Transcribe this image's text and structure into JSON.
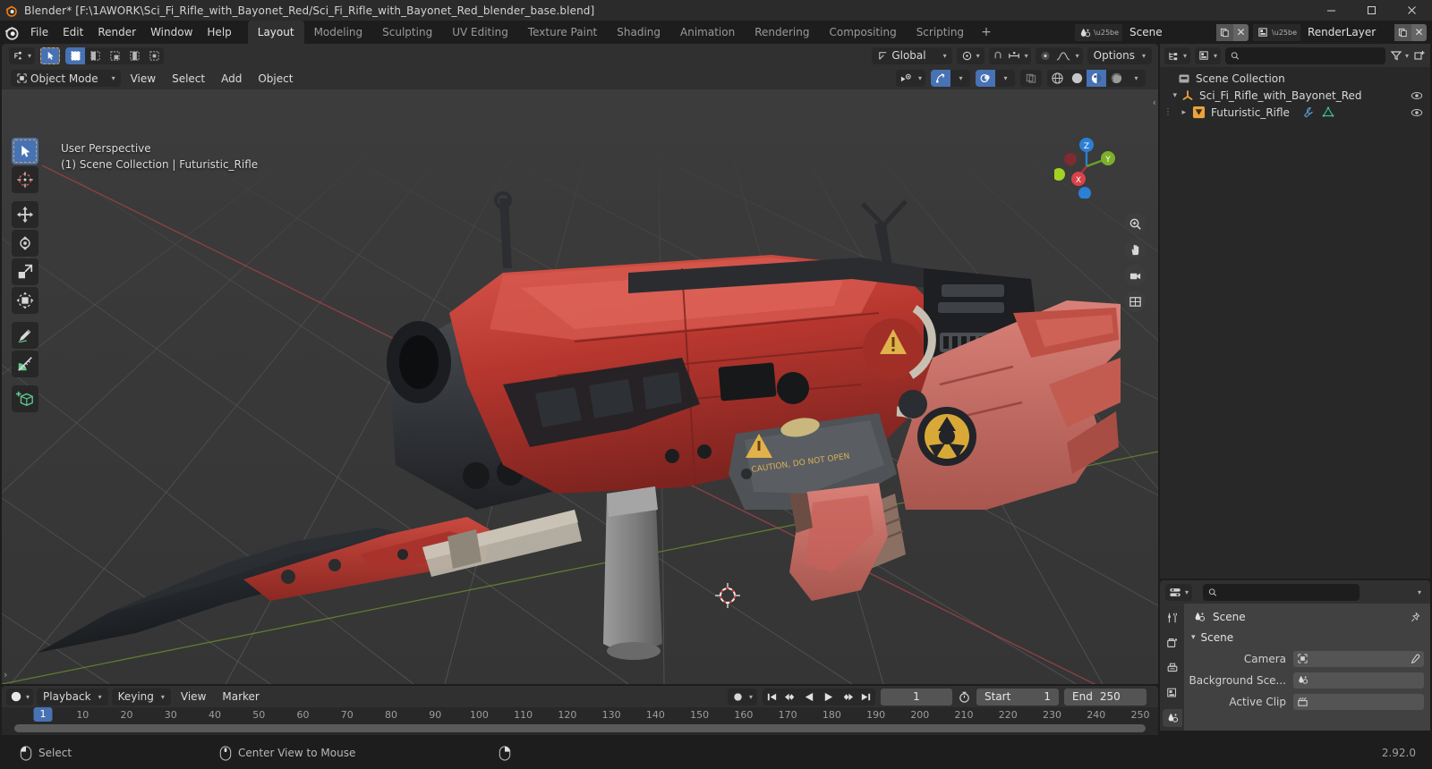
{
  "window": {
    "title": "Blender* [F:\\1AWORK\\Sci_Fi_Rifle_with_Bayonet_Red/Sci_Fi_Rifle_with_Bayonet_Red_blender_base.blend]",
    "minimize_label": "–",
    "maximize_label": "❐",
    "close_label": "✕"
  },
  "menus": [
    "File",
    "Edit",
    "Render",
    "Window",
    "Help"
  ],
  "workspaces": {
    "tabs": [
      "Layout",
      "Modeling",
      "Sculpting",
      "UV Editing",
      "Texture Paint",
      "Shading",
      "Animation",
      "Rendering",
      "Compositing",
      "Scripting"
    ],
    "active": "Layout",
    "add_label": "+"
  },
  "topbar_right": {
    "scene_name": "Scene",
    "viewlayer_name": "RenderLayer",
    "close_label": "✕"
  },
  "viewport": {
    "header": {
      "mode": "Object Mode",
      "menus": [
        "View",
        "Select",
        "Add",
        "Object"
      ],
      "transform_orientation": "Global",
      "options_label": "Options"
    },
    "overlay_line1": "User Perspective",
    "overlay_line2": "(1) Scene Collection | Futuristic_Rifle",
    "gizmo_axes": {
      "z": "Z",
      "y": "Y",
      "x": "X"
    },
    "tools": [
      "tweak-select-box-tool",
      "cursor-tool",
      "move-tool",
      "rotate-tool",
      "scale-tool",
      "transform-tool",
      "annotate-tool",
      "measure-tool",
      "add-cube-tool"
    ],
    "shading_modes": [
      "wireframe",
      "solid",
      "material-preview",
      "rendered"
    ],
    "active_shading_mode": "material-preview"
  },
  "outliner": {
    "search_placeholder": "",
    "search_value": "",
    "items": [
      {
        "label": "Scene Collection",
        "icon": "collection-icon",
        "depth": 0,
        "expander": "",
        "eye": true
      },
      {
        "label": "Sci_Fi_Rifle_with_Bayonet_Red",
        "icon": "empty-axis-icon",
        "depth": 1,
        "expander": "▾",
        "eye": true
      },
      {
        "label": "Futuristic_Rifle",
        "icon": "mesh-triangle-icon",
        "depth": 2,
        "expander": "▸",
        "eye": true
      }
    ]
  },
  "properties": {
    "search_value": "",
    "breadcrumb": "Scene",
    "section_title": "Scene",
    "rows": [
      {
        "label": "Camera",
        "value": "",
        "icon": "camera-data-icon"
      },
      {
        "label": "Background Sce...",
        "value": "",
        "icon": "scene-icon"
      },
      {
        "label": "Active Clip",
        "value": "",
        "icon": "clip-icon"
      }
    ]
  },
  "timeline": {
    "menus": [
      "Playback",
      "Keying",
      "View",
      "Marker"
    ],
    "current_frame": "1",
    "start_label": "Start",
    "start_value": "1",
    "end_label": "End",
    "end_value": "250",
    "ticks": [
      "10",
      "20",
      "30",
      "40",
      "50",
      "60",
      "70",
      "80",
      "90",
      "100",
      "110",
      "120",
      "130",
      "140",
      "150",
      "160",
      "170",
      "180",
      "190",
      "200",
      "210",
      "220",
      "230",
      "240",
      "250"
    ],
    "playhead_label": "1"
  },
  "statusbar": {
    "items": [
      {
        "icon": "mouse-left-icon",
        "label": "Select"
      },
      {
        "icon": "mouse-middle-icon",
        "label": "Center View to Mouse"
      },
      {
        "icon": "mouse-right-icon",
        "label": ""
      }
    ],
    "version": "2.92.0"
  },
  "colors": {
    "accent_blue": "#4772b3",
    "panel_bg": "#303030",
    "editor_bg": "#282828",
    "window_bg": "#1d1d1d",
    "rifle_red": "#b33a35",
    "axis_x_red": "#cc3f44",
    "axis_y_green": "#8ec342",
    "axis_z_blue": "#2b7fd4"
  }
}
